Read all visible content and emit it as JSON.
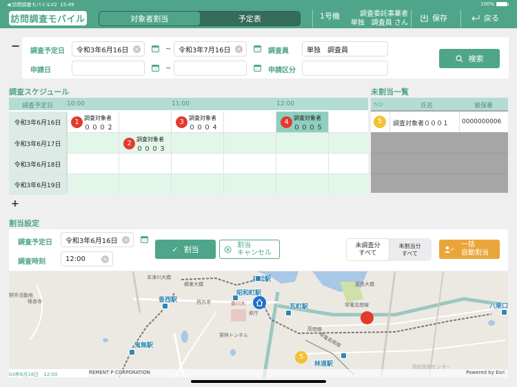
{
  "statusbar": {
    "back_app": "◀ 訪問調査モバイルV2",
    "time": "15:49",
    "battery": "100%"
  },
  "header": {
    "app_title": "訪問調査モバイル",
    "tabs": [
      {
        "label": "対象者割当",
        "active": true
      },
      {
        "label": "予定表",
        "active": false
      }
    ],
    "machine": "1号機",
    "user_line1": "調査委託事業者",
    "user_line2": "単独　調査員 さん",
    "save_label": "保存",
    "back_label": "戻る"
  },
  "search": {
    "collapse_icon": "minus",
    "fields": {
      "survey_date_label": "調査予定日",
      "survey_date_from": "令和3年6月16日",
      "survey_date_to": "令和3年7月16日",
      "apply_date_label": "申請日",
      "apply_date_from": "",
      "apply_date_to": "",
      "surveyor_label": "調査員",
      "surveyor_value": "単独　調査員",
      "apply_category_label": "申請区分",
      "apply_category_value": ""
    },
    "range_sep": "~",
    "search_button": "検索"
  },
  "schedule": {
    "title": "調査スケジュール",
    "date_header": "調査予定日",
    "time_headers": [
      "10:00",
      "11:00",
      "12:00"
    ],
    "rows": [
      {
        "date": "令和3年6月16日"
      },
      {
        "date": "令和3年6月17日"
      },
      {
        "date": "令和3年6月18日"
      },
      {
        "date": "令和3年6月19日"
      }
    ],
    "items": [
      {
        "number": "1",
        "line1": "調査対象者",
        "line2": "０００２"
      },
      {
        "number": "2",
        "line1": "調査対象者",
        "line2": "０００３"
      },
      {
        "number": "3",
        "line1": "調査対象者",
        "line2": "０００４"
      },
      {
        "number": "4",
        "line1": "調査対象者",
        "line2": "０００５"
      }
    ]
  },
  "unassigned": {
    "title": "未割当一覧",
    "headers": [
      "ｱｲｺﾝ",
      "氏名",
      "被保番"
    ],
    "rows": [
      {
        "icon_number": "5",
        "name": "調査対象者０００１",
        "insured_no": "0000000006"
      }
    ]
  },
  "expand_icon": "plus",
  "assign": {
    "title": "割当設定",
    "date_label": "調査予定日",
    "date_value": "令和3年6月16日",
    "time_label": "調査時刻",
    "time_value": "12:00",
    "assign_button": "割当",
    "cancel_button_line1": "割当",
    "cancel_button_line2": "キャンセル",
    "filter_options": [
      {
        "line1": "未調査分",
        "line2": "すべて",
        "active": true
      },
      {
        "line1": "未割当分",
        "line2": "すべて",
        "active": false
      }
    ],
    "auto_button_line1": "一括",
    "auto_button_line2": "自動割当"
  },
  "map": {
    "stations": [
      "高松駅",
      "昭和町駅",
      "香西駅",
      "瓦町駅",
      "鬼無駅",
      "林道駅",
      "八栗口"
    ],
    "labels": [
      "野外活動地",
      "根香寺",
      "本津川大橋",
      "郷東大橋",
      "西方寺",
      "香川大",
      "県庁",
      "栗林トンネル",
      "屋島大橋",
      "琴電志度線",
      "高徳線",
      "琴電長尾線",
      "高松医療センター"
    ],
    "markers": [
      {
        "type": "home"
      },
      {
        "type": "assigned",
        "color": "#e23b2e"
      },
      {
        "type": "unassigned",
        "number": "5",
        "color": "#f2c232"
      }
    ],
    "attribution_left": "REMENT P CORPORATION",
    "attribution_right": "Powered by Esri",
    "timestamp": "03年6月16日　12:00"
  }
}
